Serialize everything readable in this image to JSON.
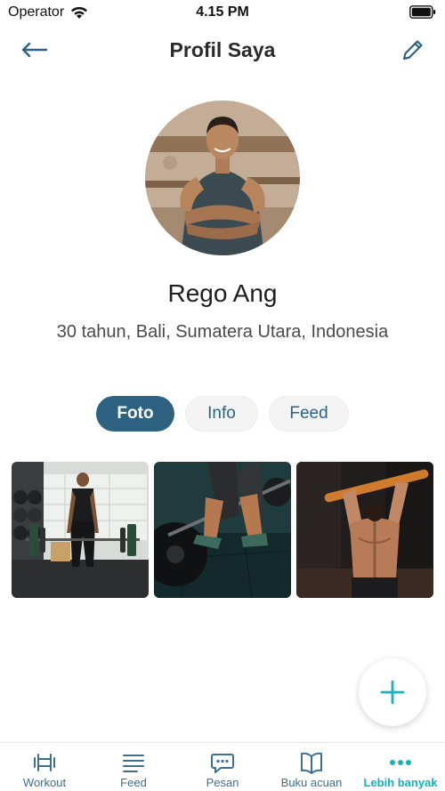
{
  "status_bar": {
    "carrier": "Operator",
    "time": "4.15 PM"
  },
  "header": {
    "title": "Profil Saya"
  },
  "profile": {
    "name": "Rego Ang",
    "details": "30 tahun, Bali, Sumatera Utara, Indonesia"
  },
  "tabs": [
    {
      "label": "Foto",
      "active": true
    },
    {
      "label": "Info",
      "active": false
    },
    {
      "label": "Feed",
      "active": false
    }
  ],
  "photos": [
    {
      "subject": "man-deadlift-barbell-gym"
    },
    {
      "subject": "barbell-lift-closeup"
    },
    {
      "subject": "back-muscles-pullup"
    }
  ],
  "bottom_nav": [
    {
      "label": "Workout",
      "icon": "dumbbell-icon",
      "active": false
    },
    {
      "label": "Feed",
      "icon": "feed-lines-icon",
      "active": false
    },
    {
      "label": "Pesan",
      "icon": "chat-bubble-icon",
      "active": false
    },
    {
      "label": "Buku acuan",
      "icon": "book-icon",
      "active": false
    },
    {
      "label": "Lebih banyak",
      "icon": "more-dots-icon",
      "active": true
    }
  ],
  "colors": {
    "primary": "#2d6283",
    "accent": "#17b1c0",
    "nav_inactive": "#3d6f8e"
  }
}
